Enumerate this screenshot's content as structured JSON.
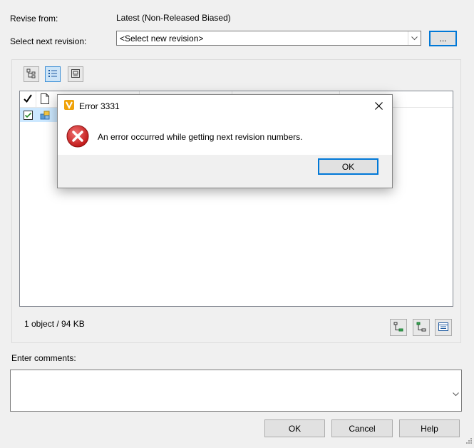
{
  "form": {
    "revise_from_label": "Revise from:",
    "revise_from_value": "Latest (Non-Released Biased)",
    "select_next_label": "Select next revision:",
    "select_placeholder": "<Select new revision>",
    "browse_label": "...",
    "status": "1 object / 94 KB",
    "comments_label": "Enter comments:"
  },
  "buttons": {
    "ok": "OK",
    "cancel": "Cancel",
    "help": "Help"
  },
  "dialog": {
    "title": "Error 3331",
    "message": "An error occurred while getting next revision numbers.",
    "ok": "OK"
  },
  "icons": {
    "app": "vault-icon",
    "error": "error-icon",
    "close": "close-icon"
  },
  "colors": {
    "accent": "#0078d7",
    "error_red": "#d32f2f",
    "app_gold": "#f0a30a"
  }
}
